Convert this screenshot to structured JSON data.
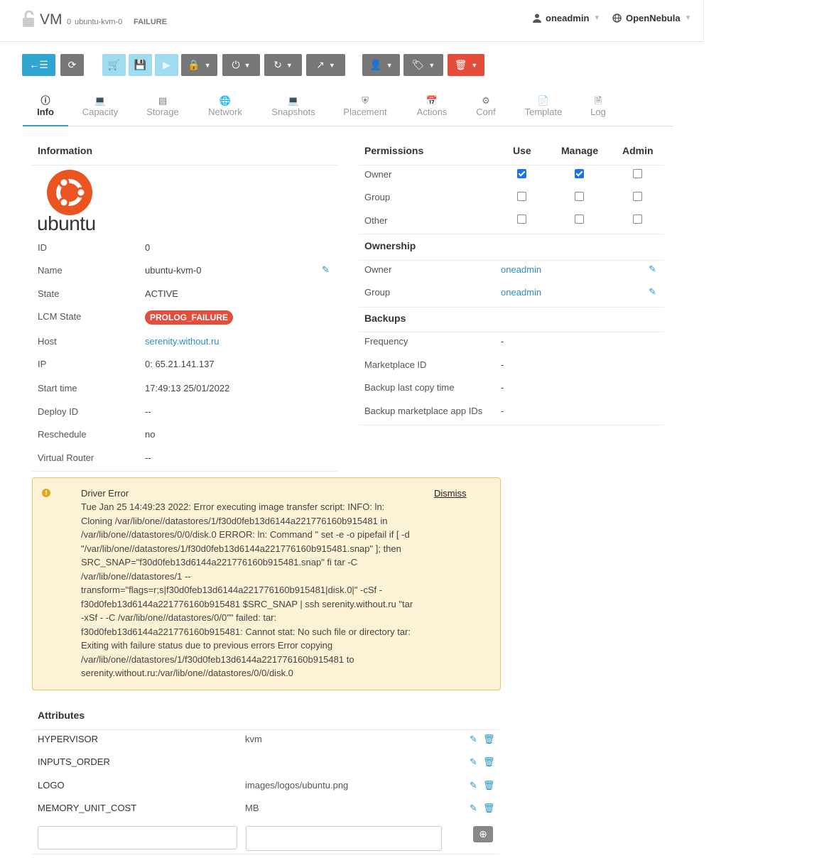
{
  "header": {
    "title": "VM",
    "vm_id": "0",
    "vm_name": "ubuntu-kvm-0",
    "vm_state": "FAILURE",
    "user": "oneadmin",
    "zone": "OpenNebula"
  },
  "colors": {
    "accent": "#2fa6d1",
    "danger": "#e44c3b",
    "warning_bg": "#fdf2d5"
  },
  "tabs": [
    {
      "label": "Info",
      "icon": "info-icon"
    },
    {
      "label": "Capacity",
      "icon": "laptop-icon"
    },
    {
      "label": "Storage",
      "icon": "storage-icon"
    },
    {
      "label": "Network",
      "icon": "globe-icon"
    },
    {
      "label": "Snapshots",
      "icon": "laptop-icon"
    },
    {
      "label": "Placement",
      "icon": "sitemap-icon"
    },
    {
      "label": "Actions",
      "icon": "calendar-icon"
    },
    {
      "label": "Conf",
      "icon": "gear-icon"
    },
    {
      "label": "Template",
      "icon": "file-icon"
    },
    {
      "label": "Log",
      "icon": "file-text-icon"
    }
  ],
  "information": {
    "heading": "Information",
    "logo_text": "ubuntu",
    "rows": [
      {
        "label": "ID",
        "value": "0"
      },
      {
        "label": "Name",
        "value": "ubuntu-kvm-0"
      },
      {
        "label": "State",
        "value": "ACTIVE"
      },
      {
        "label": "LCM State",
        "value": "PROLOG_FAILURE"
      },
      {
        "label": "Host",
        "value": "serenity.without.ru"
      },
      {
        "label": "IP",
        "value": "0: 65.21.141.137"
      },
      {
        "label": "Start time",
        "value": "17:49:13 25/01/2022"
      },
      {
        "label": "Deploy ID",
        "value": "--"
      },
      {
        "label": "Reschedule",
        "value": "no"
      },
      {
        "label": "Virtual Router",
        "value": "--"
      }
    ]
  },
  "permissions": {
    "heading": "Permissions",
    "columns": [
      "Use",
      "Manage",
      "Admin"
    ],
    "rows": [
      {
        "label": "Owner",
        "checks": [
          true,
          true,
          false
        ]
      },
      {
        "label": "Group",
        "checks": [
          false,
          false,
          false
        ]
      },
      {
        "label": "Other",
        "checks": [
          false,
          false,
          false
        ]
      }
    ]
  },
  "ownership": {
    "heading": "Ownership",
    "rows": [
      {
        "label": "Owner",
        "value": "oneadmin"
      },
      {
        "label": "Group",
        "value": "oneadmin"
      }
    ]
  },
  "backups": {
    "heading": "Backups",
    "rows": [
      {
        "label": "Frequency",
        "value": "-"
      },
      {
        "label": "Marketplace ID",
        "value": "-"
      },
      {
        "label": "Backup last copy time",
        "value": "-"
      },
      {
        "label": "Backup marketplace app IDs",
        "value": "-"
      }
    ]
  },
  "error": {
    "title": "Driver Error",
    "dismiss": "Dismiss",
    "message": "Tue Jan 25 14:49:23 2022: Error executing image transfer script: INFO: ln: Cloning /var/lib/one//datastores/1/f30d0feb13d6144a221776160b915481 in /var/lib/one//datastores/0/0/disk.0 ERROR: ln: Command \" set -e -o pipefail if [ -d \"/var/lib/one//datastores/1/f30d0feb13d6144a221776160b915481.snap\" ]; then SRC_SNAP=\"f30d0feb13d6144a221776160b915481.snap\" fi tar -C /var/lib/one//datastores/1 --transform=\"flags=r;s|f30d0feb13d6144a221776160b915481|disk.0|\" -cSf - f30d0feb13d6144a221776160b915481 $SRC_SNAP | ssh serenity.without.ru \"tar -xSf - -C /var/lib/one//datastores/0/0\"\" failed: tar: f30d0feb13d6144a221776160b915481: Cannot stat: No such file or directory tar: Exiting with failure status due to previous errors Error copying /var/lib/one//datastores/1/f30d0feb13d6144a221776160b915481 to serenity.without.ru:/var/lib/one//datastores/0/0/disk.0"
  },
  "attributes": {
    "heading": "Attributes",
    "rows": [
      {
        "key": "HYPERVISOR",
        "value": "kvm"
      },
      {
        "key": "INPUTS_ORDER",
        "value": ""
      },
      {
        "key": "LOGO",
        "value": "images/logos/ubuntu.png"
      },
      {
        "key": "MEMORY_UNIT_COST",
        "value": "MB"
      }
    ],
    "new_key": "",
    "new_value": ""
  }
}
